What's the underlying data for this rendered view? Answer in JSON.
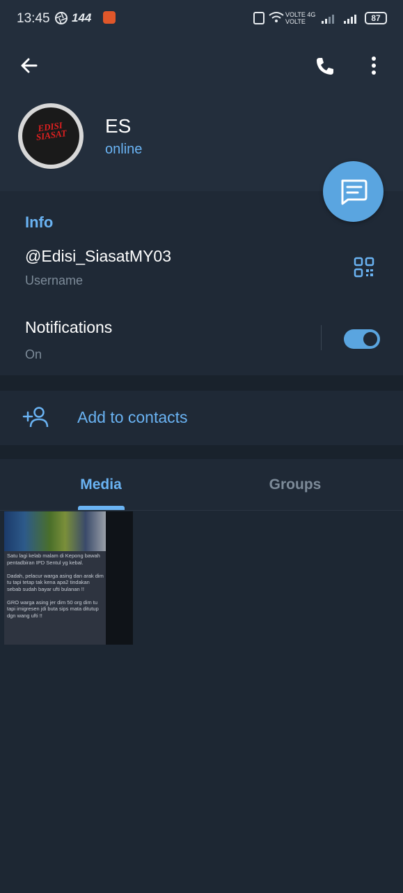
{
  "status_bar": {
    "time": "13:45",
    "refresh_rate": "144",
    "network_label": "VOLTE 4G\nVOLTE",
    "battery": "87"
  },
  "header": {
    "back_icon": "arrow-left-icon",
    "call_icon": "phone-icon",
    "menu_icon": "more-vertical-icon",
    "avatar_text": "EDISI SIASAT",
    "name": "ES",
    "status": "online"
  },
  "fab": {
    "icon": "message-icon"
  },
  "info": {
    "title": "Info",
    "username": "@Edisi_SiasatMY03",
    "username_label": "Username",
    "qr_icon": "qr-code-icon",
    "notifications_title": "Notifications",
    "notifications_state": "On",
    "notifications_enabled": true
  },
  "contacts": {
    "icon": "add-user-icon",
    "label": "Add to contacts"
  },
  "tabs": [
    {
      "label": "Media",
      "active": true
    },
    {
      "label": "Groups",
      "active": false
    }
  ],
  "media": {
    "items": [
      {
        "text": "Satu lagi kelab malam di Kepong bawah pentadbiran IPD Sentul yg kebal.\n\nDadah, pelacur warga asing dan arak dim tu tapi tetap tak kena apa2 tindakan sebab sudah bayar ufti bulanan !!\n\nGRO warga asing jer dim 50 org dim tu tapi imigresen jdi buta sips mata ditutup dgn wang ufti !!"
      }
    ]
  },
  "colors": {
    "background": "#1d2733",
    "header": "#232e3c",
    "accent": "#6ab3f3",
    "fab": "#5aa5e0",
    "muted": "#7d8b99"
  }
}
